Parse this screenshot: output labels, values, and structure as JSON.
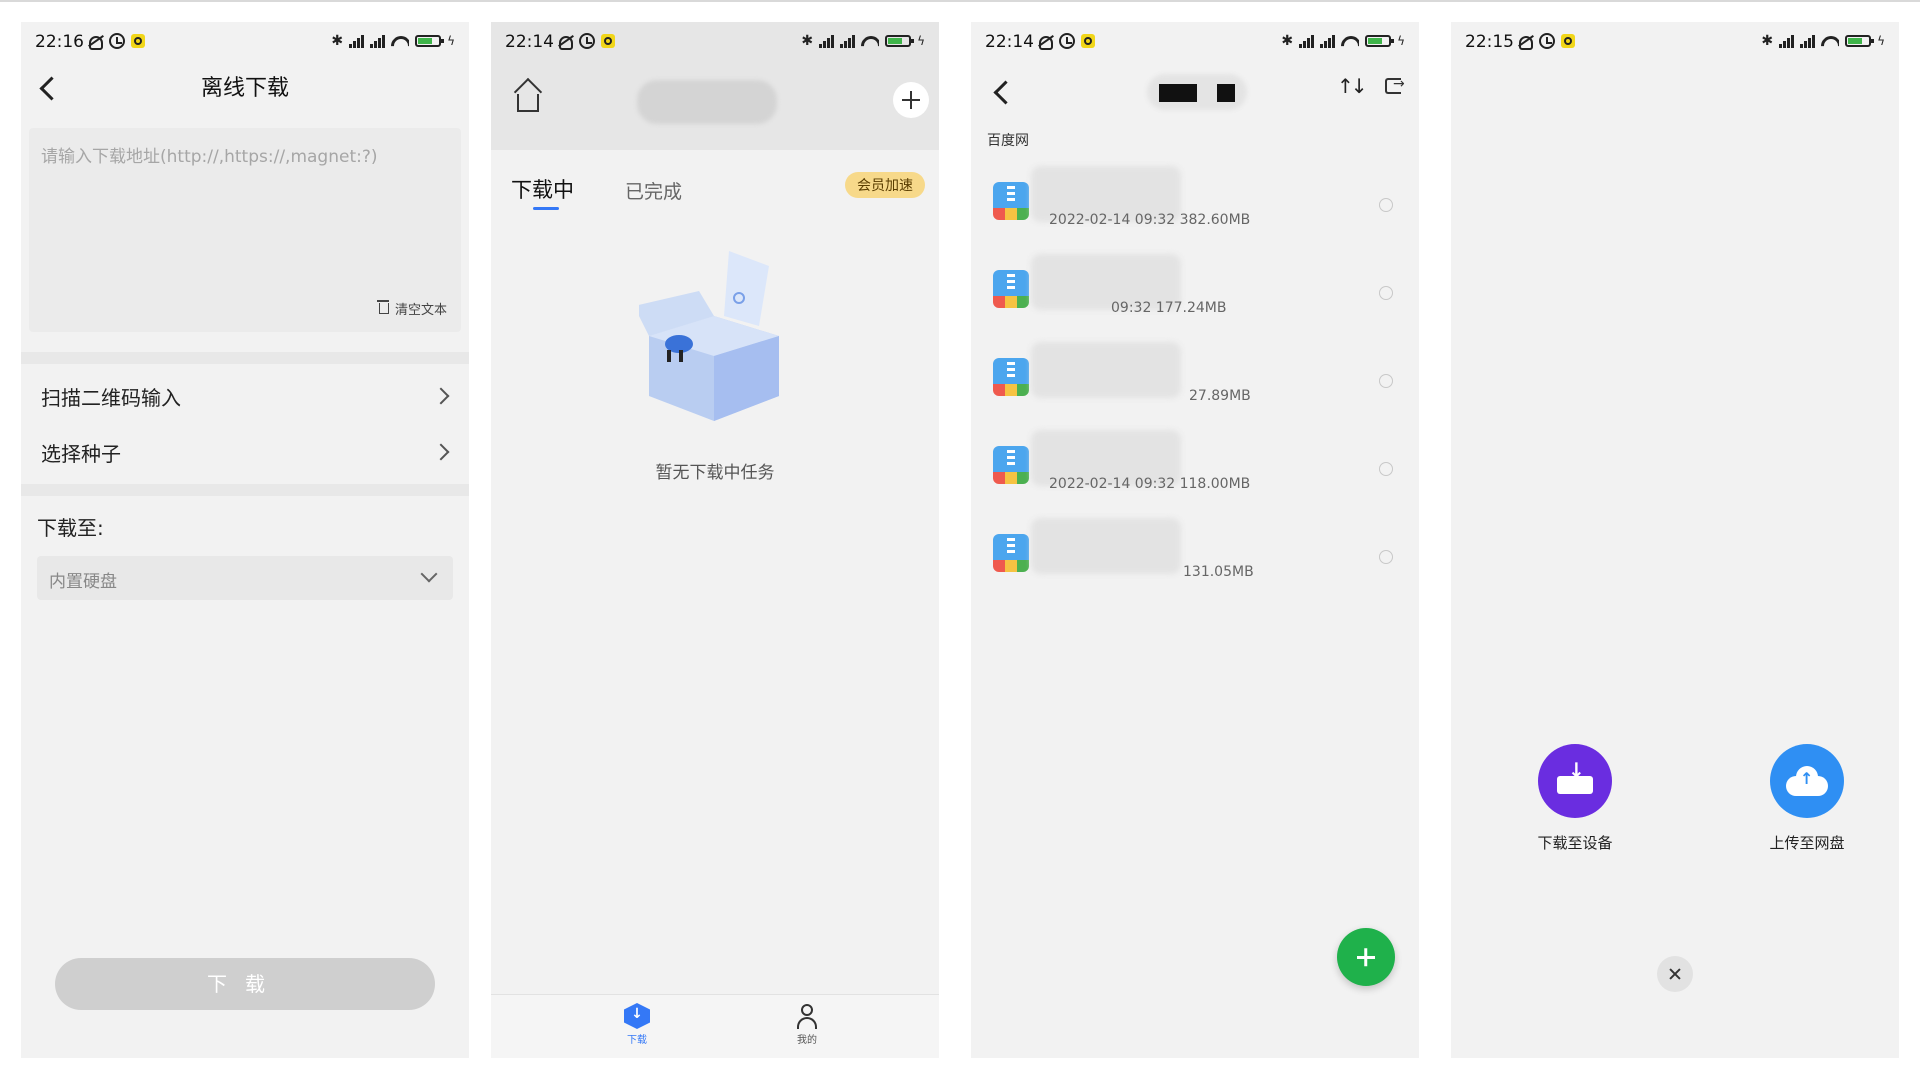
{
  "screens": [
    {
      "status": {
        "time": "22:16"
      },
      "title": "离线下载",
      "url_input": {
        "placeholder": "请输入下载地址(http://,https://,magnet:?)",
        "clear_label": "清空文本"
      },
      "menu": [
        {
          "label": "扫描二维码输入"
        },
        {
          "label": "选择种子"
        }
      ],
      "download_to_label": "下载至:",
      "storage_select": {
        "value": "内置硬盘"
      },
      "download_button": "下载"
    },
    {
      "status": {
        "time": "22:14"
      },
      "tabs": [
        {
          "label": "下载中"
        },
        {
          "label": "已完成"
        }
      ],
      "vip_badge": "会员加速",
      "empty_text": "暂无下载中任务",
      "nav": [
        {
          "label": "下载"
        },
        {
          "label": "我的"
        }
      ]
    },
    {
      "status": {
        "time": "22:14"
      },
      "breadcrumb": "百度网",
      "files": [
        {
          "meta": "2022-02-14 09:32   382.60MB"
        },
        {
          "meta": "09:32   177.24MB"
        },
        {
          "meta": "27.89MB"
        },
        {
          "meta": "2022-02-14 09:32   118.00MB"
        },
        {
          "meta": "131.05MB"
        }
      ]
    },
    {
      "status": {
        "time": "22:15"
      },
      "actions": [
        {
          "label": "下载至设备",
          "icon": "download-device-icon",
          "color": "#6a2de0"
        },
        {
          "label": "上传至网盘",
          "icon": "cloud-upload-icon",
          "color": "#2f8ff3"
        }
      ]
    }
  ],
  "colors": {
    "accent_blue": "#3478f6",
    "fab_green": "#1fb14b",
    "vip_gold": "#f7d98a"
  }
}
